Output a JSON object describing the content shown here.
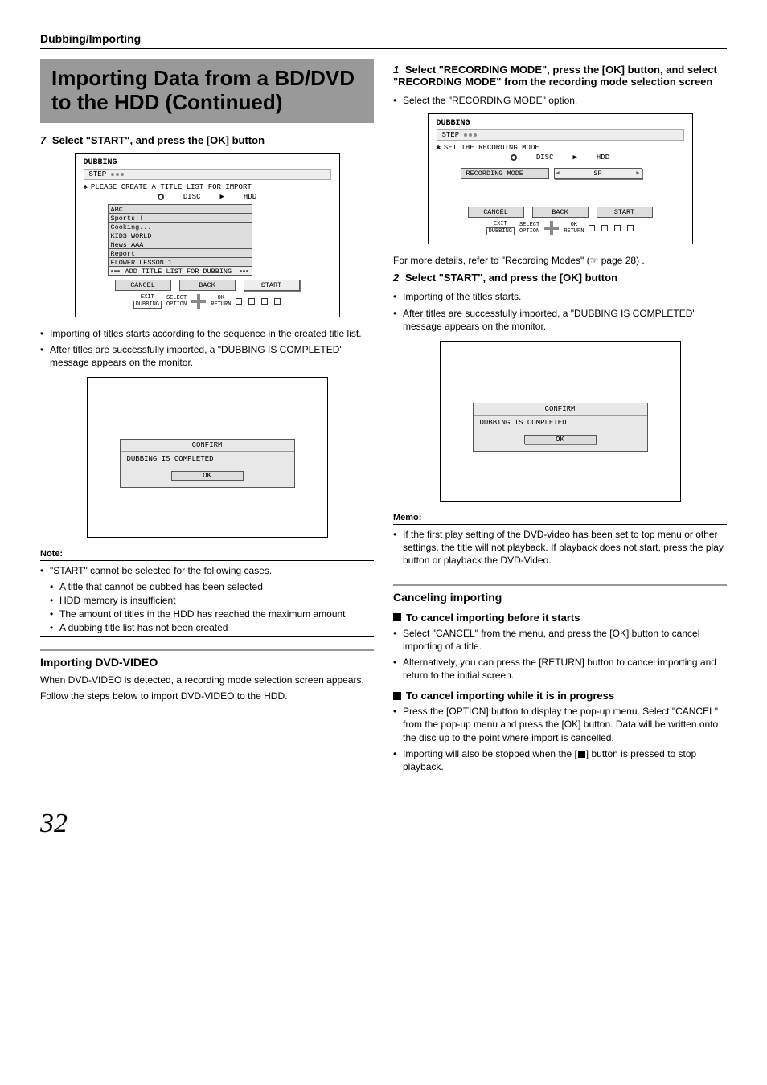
{
  "section_title": "Dubbing/Importing",
  "main_heading": "Importing Data from a BD/DVD to the HDD (Continued)",
  "left": {
    "step7": "Select \"START\", and press the [OK] button",
    "ui1": {
      "title": "DUBBING",
      "step_label": "STEP",
      "prompt": "PLEASE CREATE A TITLE LIST FOR IMPORT",
      "disc": "DISC",
      "hdd": "HDD",
      "list": [
        "ABC",
        "Sports!!",
        "Cooking...",
        "KIDS WORLD",
        "News AAA",
        "Report",
        "FLOWER LESSON 1"
      ],
      "add": "ADD TITLE LIST FOR DUBBING",
      "cancel": "CANCEL",
      "back": "BACK",
      "start": "START",
      "exit": "EXIT",
      "dubbing_btn": "DUBBING",
      "select": "SELECT",
      "ok": "OK",
      "option": "OPTION",
      "return": "RETURN"
    },
    "bullets": [
      "Importing of titles starts according to the sequence in the created title list.",
      "After titles are successfully imported, a \"DUBBING IS COMPLETED\" message appears on the monitor."
    ],
    "confirm": {
      "head": "CONFIRM",
      "msg": "DUBBING IS COMPLETED",
      "ok": "OK"
    },
    "note_label": "Note:",
    "note_intro": "\"START\" cannot be selected for the following cases.",
    "note_items": [
      "A title that cannot be dubbed has been selected",
      "HDD memory is insufficient",
      "The amount of titles in the HDD has reached the maximum amount",
      "A dubbing title list has not been created"
    ],
    "dvd_head": "Importing DVD-VIDEO",
    "dvd_p1": "When DVD-VIDEO is detected, a recording mode selection screen appears.",
    "dvd_p2": "Follow the steps below to import DVD-VIDEO to the HDD."
  },
  "right": {
    "step1": "Select \"RECORDING MODE\", press the [OK] button, and select \"RECORDING MODE\" from the recording mode selection screen",
    "step1_sub": "Select the \"RECORDING MODE\" option.",
    "ui2": {
      "title": "DUBBING",
      "step_label": "STEP",
      "prompt": "SET THE RECORDING MODE",
      "disc": "DISC",
      "hdd": "HDD",
      "rec_label": "RECORDING MODE",
      "rec_val": "SP",
      "cancel": "CANCEL",
      "back": "BACK",
      "start": "START",
      "exit": "EXIT",
      "dubbing_btn": "DUBBING",
      "select": "SELECT",
      "ok": "OK",
      "option": "OPTION",
      "return": "RETURN"
    },
    "ref_line_pre": "For more details, refer to \"Recording Modes\" (",
    "ref_symbol": "☞",
    "ref_line_post": " page 28) .",
    "step2": "Select \"START\", and press the [OK] button",
    "step2_b1": "Importing of the titles starts.",
    "step2_b2": "After titles are successfully imported, a \"DUBBING IS COMPLETED\" message appears on the monitor.",
    "confirm": {
      "head": "CONFIRM",
      "msg": "DUBBING IS COMPLETED",
      "ok": "OK"
    },
    "memo_label": "Memo:",
    "memo_text": "If the first play setting of the DVD-video has been set to top menu or other settings, the title will not playback. If playback does not start, press the play button or playback the DVD-Video.",
    "cancel_head": "Canceling importing",
    "cancel_before": "To cancel importing before it starts",
    "cancel_before_b1": "Select \"CANCEL\" from the menu, and press the [OK] button to cancel importing of a title.",
    "cancel_before_b2": "Alternatively, you can press the [RETURN] button to cancel importing and return to the initial screen.",
    "cancel_prog": "To cancel importing while it is in progress",
    "cancel_prog_b1": "Press the [OPTION] button to display the pop-up menu. Select \"CANCEL\" from the pop-up menu and press the [OK] button. Data will be written onto the disc up to the point where import is cancelled.",
    "cancel_prog_b2_pre": "Importing will also be stopped when the [",
    "cancel_prog_b2_post": "] button is pressed to stop playback."
  },
  "page_number": "32"
}
